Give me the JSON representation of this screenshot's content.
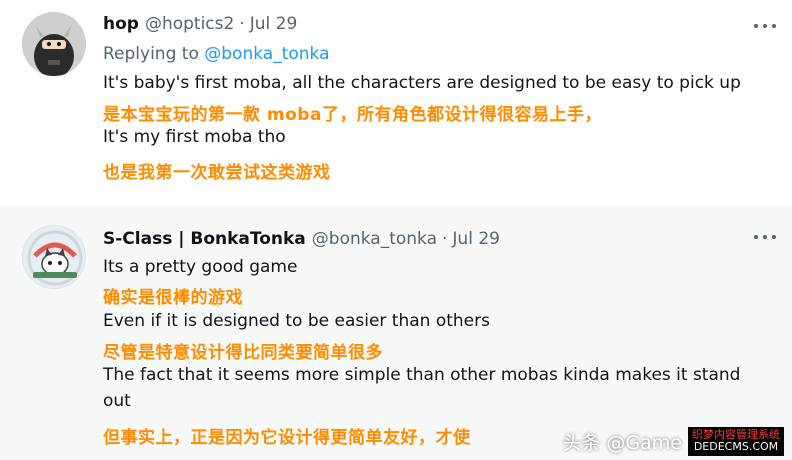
{
  "tweets": [
    {
      "author": {
        "name": "hop",
        "handle": "@hoptics2"
      },
      "separator": "·",
      "date": "Jul 29",
      "replying_label": "Replying to",
      "replying_handle": "@bonka_tonka",
      "lines": [
        "It's baby's first moba, all the characters are designed to be easy to pick up",
        "是本宝宝玩的第一款 moba了，所有角色都设计得很容易上手，",
        "It's my first moba tho",
        "也是我第一次敢尝试这类游戏"
      ]
    },
    {
      "author": {
        "name": "S-Class | BonkaTonka",
        "handle": "@bonka_tonka"
      },
      "separator": "·",
      "date": "Jul 29",
      "lines": [
        "Its a pretty good game",
        "确实是很棒的游戏",
        "Even if it is designed to be easier than others",
        "尽管是特意设计得比同类要简单很多",
        "The fact that it seems more simple than other mobas kinda makes it stand",
        "out",
        "但事实上，正是因为它设计得更简单友好，才使"
      ]
    }
  ],
  "watermark": {
    "text": "头条 @Game",
    "badge_top": "织梦内容管理系统",
    "badge_bottom": "DEDECMS.COM"
  },
  "colors": {
    "accent": "#1d9bf0",
    "translation": "#ff8c00",
    "muted": "#536471"
  }
}
